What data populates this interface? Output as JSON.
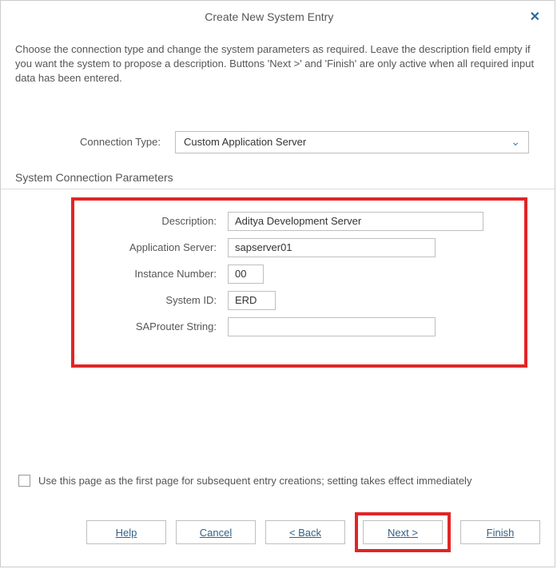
{
  "title": "Create New System Entry",
  "intro": "Choose the connection type and change the system parameters as required. Leave the description field empty if you want the system to propose a description. Buttons 'Next >' and 'Finish' are only active when all required input data has been entered.",
  "connType": {
    "label": "Connection Type:",
    "value": "Custom Application Server"
  },
  "sectionHeader": "System Connection Parameters",
  "fields": {
    "description": {
      "label": "Description:",
      "value": "Aditya Development Server"
    },
    "appServer": {
      "label": "Application Server:",
      "value": "sapserver01"
    },
    "instanceNum": {
      "label": "Instance Number:",
      "value": "00"
    },
    "systemId": {
      "label": "System ID:",
      "value": "ERD"
    },
    "saprouter": {
      "label": "SAProuter String:",
      "value": ""
    }
  },
  "checkboxLabel": "Use this page as the first page for subsequent entry creations; setting takes effect immediately",
  "buttons": {
    "help": "Help",
    "cancel": "Cancel",
    "back": "< Back",
    "next": "Next >",
    "finish": "Finish"
  }
}
